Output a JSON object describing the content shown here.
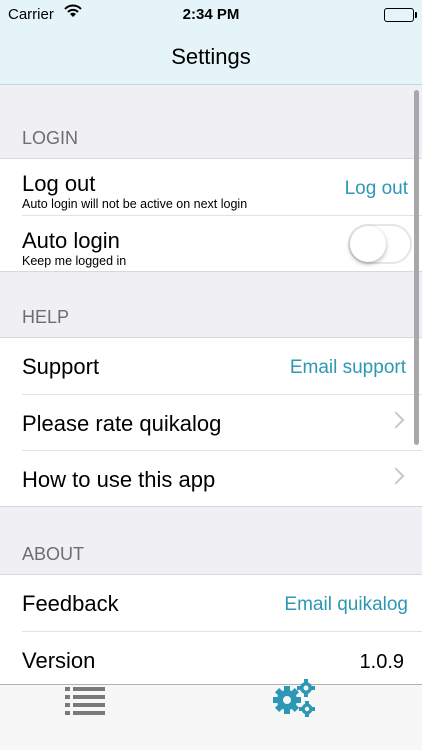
{
  "status_bar": {
    "carrier": "Carrier",
    "time": "2:34 PM"
  },
  "nav": {
    "title": "Settings"
  },
  "sections": {
    "login": {
      "header": "LOGIN",
      "logout": {
        "title": "Log out",
        "subtitle": "Auto login will not be active on next login",
        "action": "Log out"
      },
      "autologin": {
        "title": "Auto login",
        "subtitle": "Keep me logged in",
        "enabled": false
      }
    },
    "help": {
      "header": "HELP",
      "support": {
        "title": "Support",
        "action": "Email support"
      },
      "rate": {
        "title": "Please rate quikalog"
      },
      "howto": {
        "title": "How to use this app"
      }
    },
    "about": {
      "header": "ABOUT",
      "feedback": {
        "title": "Feedback",
        "action": "Email quikalog"
      },
      "version": {
        "title": "Version",
        "value": "1.0.9"
      }
    }
  },
  "tabs": [
    {
      "icon": "list-icon",
      "selected": false
    },
    {
      "icon": "gears-icon",
      "selected": true
    }
  ],
  "colors": {
    "accent": "#2d97b6",
    "nav_background": "#e5f4f8",
    "group_background": "#efeff4"
  }
}
